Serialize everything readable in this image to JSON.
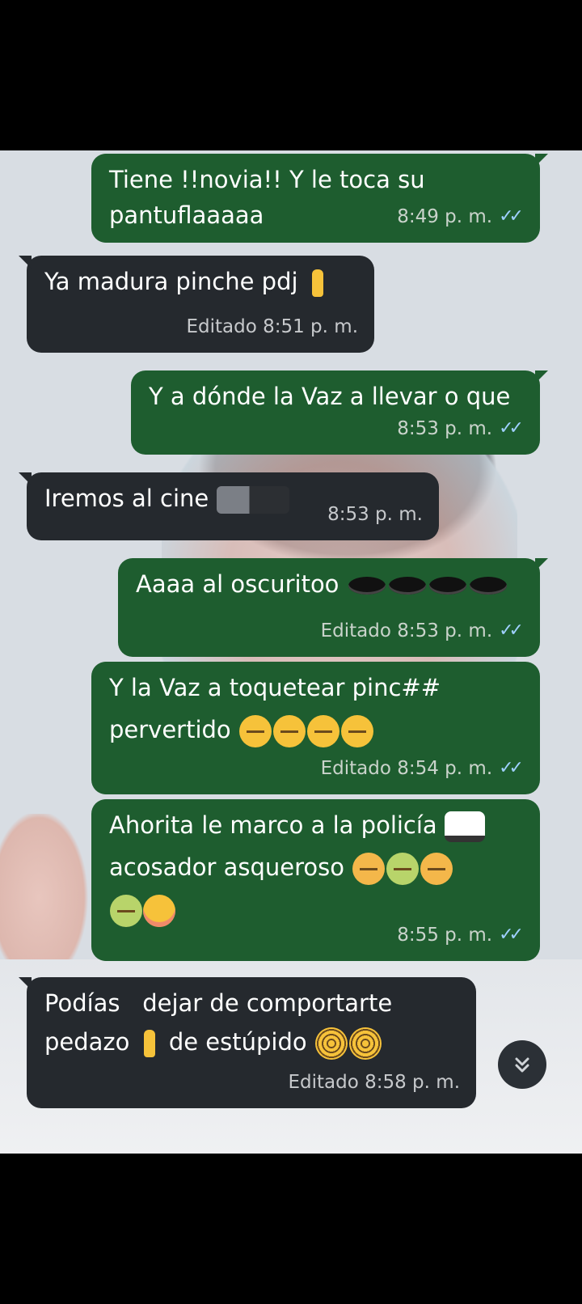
{
  "messages": [
    {
      "text_line1": "Tiene !!novia!! Y le toca su",
      "text_line2": "pantuflaaaaa",
      "time": "8:49 p. m."
    },
    {
      "text": "Ya  madura pinche pdj",
      "time": "Editado 8:51 p. m."
    },
    {
      "text": "Y a dónde la Vaz a llevar o que",
      "time": "8:53 p. m."
    },
    {
      "text": "Iremos al cine",
      "time": "8:53 p. m."
    },
    {
      "text": "Aaaa al oscuritoo",
      "time": "Editado 8:53 p. m."
    },
    {
      "text_line1": "Y la Vaz a toquetear pinc##",
      "text_line2": "pervertido",
      "time": "Editado 8:54 p. m."
    },
    {
      "text_line1": "Ahorita le marco a la  policía",
      "text_line2": "acosador asqueroso",
      "time": "8:55 p. m."
    },
    {
      "text_line1": "Podías   dejar de comportarte",
      "text_line2a": "pedazo",
      "text_line2b": "de estúpido",
      "time": "Editado 8:58 p. m."
    }
  ],
  "icons": {
    "read_receipt": "double-check-icon",
    "scroll_down": "chevron-double-down-icon"
  },
  "colors": {
    "outgoing_bubble": "#1e5d2f",
    "incoming_bubble": "#25292e",
    "read_ticks": "#9fd0ff"
  }
}
